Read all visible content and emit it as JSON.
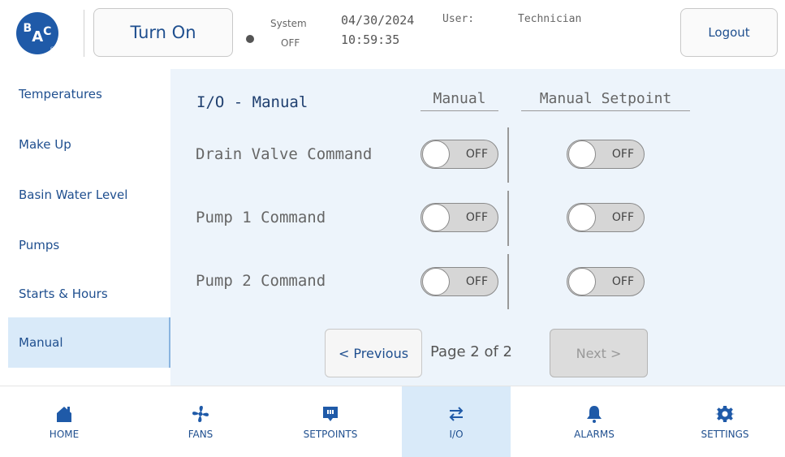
{
  "header": {
    "logo_text": "BAC",
    "turn_on_label": "Turn On",
    "system_label": "System",
    "system_state": "OFF",
    "date": "04/30/2024",
    "time": "10:59:35",
    "user_label": "User:",
    "user_name": "Technician",
    "logout_label": "Logout"
  },
  "sidebar": {
    "items": [
      {
        "label": "Temperatures"
      },
      {
        "label": "Make Up"
      },
      {
        "label": "Basin Water Level"
      },
      {
        "label": "Pumps"
      },
      {
        "label": "Starts & Hours"
      },
      {
        "label": "Manual"
      }
    ],
    "active": "Manual"
  },
  "main": {
    "title": "I/O - Manual",
    "columns": {
      "manual": "Manual",
      "setpoint": "Manual Setpoint"
    },
    "rows": [
      {
        "label": "Drain Valve Command",
        "manual": "OFF",
        "setpoint": "OFF"
      },
      {
        "label": "Pump 1 Command",
        "manual": "OFF",
        "setpoint": "OFF"
      },
      {
        "label": "Pump 2 Command",
        "manual": "OFF",
        "setpoint": "OFF"
      }
    ],
    "pager": {
      "previous_label": "< Previous",
      "page_indicator": "Page 2 of 2",
      "next_label": "Next >"
    }
  },
  "bottom_nav": {
    "items": [
      {
        "label": "HOME",
        "icon": "home-icon"
      },
      {
        "label": "FANS",
        "icon": "fan-icon"
      },
      {
        "label": "SETPOINTS",
        "icon": "setpoints-icon"
      },
      {
        "label": "I/O",
        "icon": "io-arrows-icon"
      },
      {
        "label": "ALARMS",
        "icon": "bell-icon"
      },
      {
        "label": "SETTINGS",
        "icon": "gear-icon"
      }
    ],
    "active": "I/O"
  },
  "colors": {
    "brand": "#1f5aa8",
    "accent_text": "#1f4f8f",
    "panel_bg": "#edf4fb",
    "active_bg": "#d9eaf9"
  }
}
